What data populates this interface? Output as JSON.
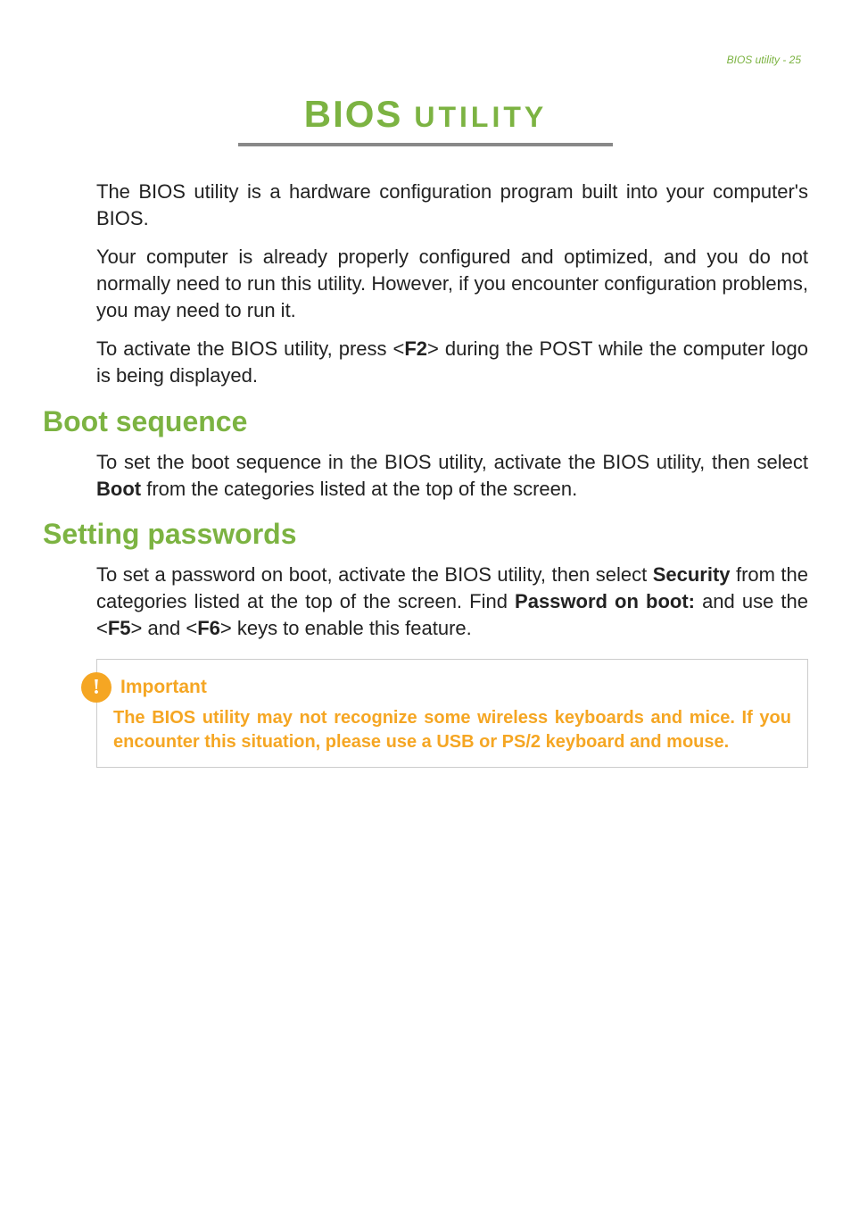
{
  "header": {
    "breadcrumb": "BIOS utility - 25"
  },
  "title": {
    "part1": "BIOS",
    "part2": " UTILITY"
  },
  "paragraphs": {
    "intro1": "The BIOS utility is a hardware configuration program built into your computer's BIOS.",
    "intro2": "Your computer is already properly configured and optimized, and you do not normally need to run this utility. However, if you encounter configuration problems, you may need to run it.",
    "intro3_pre": "To activate the BIOS utility, press <",
    "intro3_key": "F2",
    "intro3_post": "> during the POST while the computer logo is being displayed."
  },
  "sections": {
    "boot": {
      "heading": "Boot sequence",
      "body_pre": "To set the boot sequence in the BIOS utility, activate the BIOS utility, then select ",
      "body_bold": "Boot",
      "body_post": " from the categories listed at the top of the screen."
    },
    "passwords": {
      "heading": "Setting passwords",
      "body_pre": "To set a password on boot, activate the BIOS utility, then select ",
      "body_bold1": "Security",
      "body_mid1": " from the categories listed at the top of the screen. Find ",
      "body_bold2": "Password on boot:",
      "body_mid2": " and use the <",
      "body_key1": "F5",
      "body_mid3": "> and <",
      "body_key2": "F6",
      "body_post": "> keys to enable this feature."
    }
  },
  "callout": {
    "icon_mark": "!",
    "title": "Important",
    "body": "The BIOS utility may  not recognize some wireless keyboards and mice. If you encounter this situation, please use a USB or PS/2 keyboard and mouse."
  }
}
